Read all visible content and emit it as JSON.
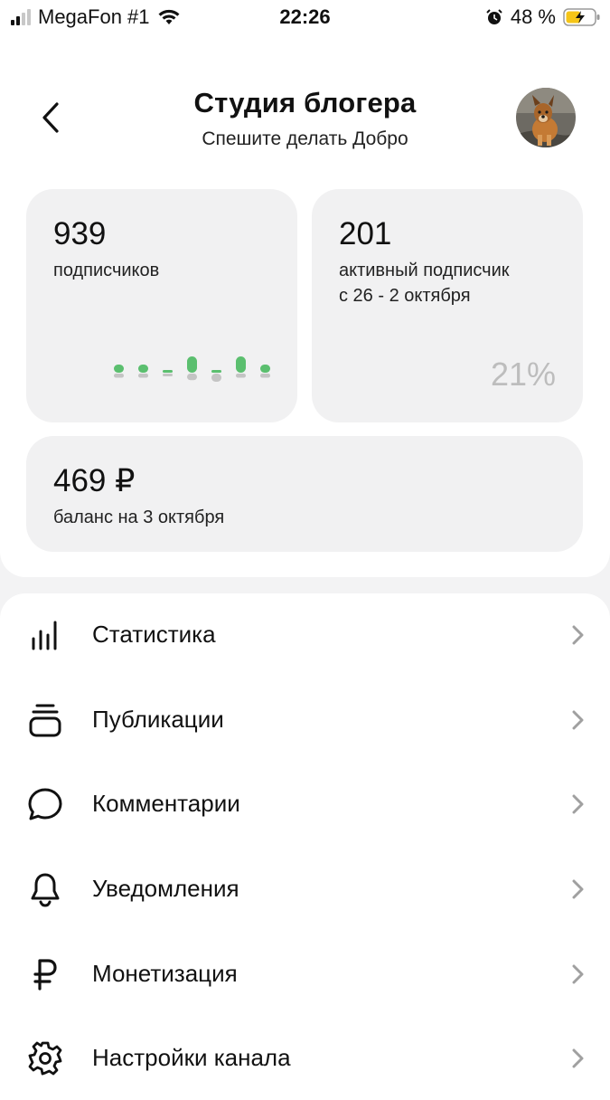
{
  "status_bar": {
    "carrier": "MegaFon #1",
    "time": "22:26",
    "battery_percent": "48 %"
  },
  "header": {
    "title": "Студия блогера",
    "subtitle": "Спешите делать Добро"
  },
  "stats": {
    "subscribers": {
      "value": "939",
      "label": "подписчиков"
    },
    "active": {
      "value": "201",
      "label_line1": "активный подписчик",
      "label_line2": "с 26 - 2 октября",
      "percent": "21%"
    },
    "balance": {
      "value": "469 ₽",
      "label": "баланс на 3 октября"
    }
  },
  "mini_chart": {
    "gains": [
      1,
      1,
      0.3,
      2,
      0,
      2,
      1
    ],
    "losses": [
      0.5,
      0.5,
      0.3,
      0.8,
      1,
      0.5,
      0.5
    ],
    "gain_color": "#5bbf6f",
    "loss_color": "#c4c4c4"
  },
  "menu": {
    "items": [
      {
        "label": "Статистика",
        "icon": "bar-chart-icon"
      },
      {
        "label": "Публикации",
        "icon": "stack-icon"
      },
      {
        "label": "Комментарии",
        "icon": "speech-bubble-icon"
      },
      {
        "label": "Уведомления",
        "icon": "bell-icon"
      },
      {
        "label": "Монетизация",
        "icon": "ruble-icon"
      },
      {
        "label": "Настройки канала",
        "icon": "gear-icon"
      }
    ]
  }
}
